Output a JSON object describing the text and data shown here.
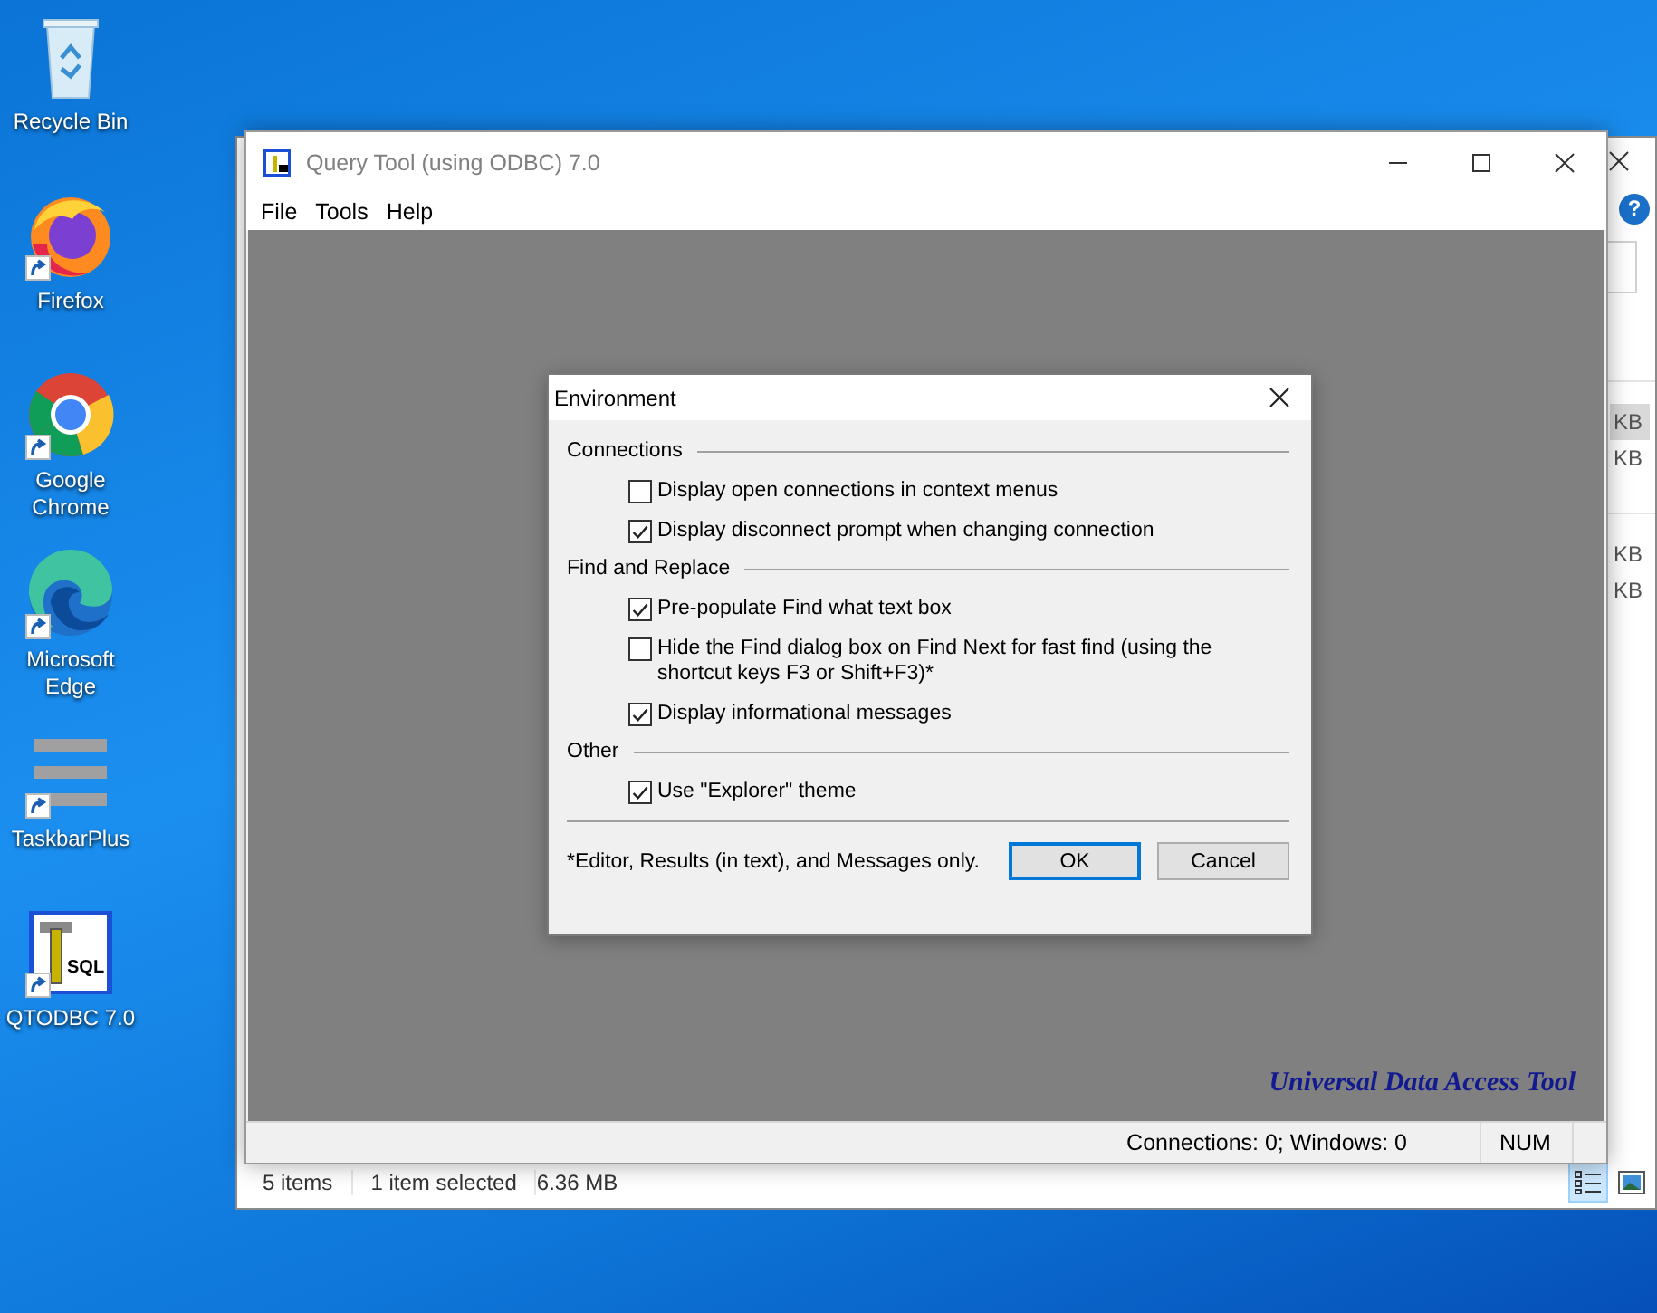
{
  "desktop": {
    "icons": [
      {
        "label": "Recycle Bin",
        "kind": "recycle",
        "shortcut": false
      },
      {
        "label": "Firefox",
        "kind": "firefox",
        "shortcut": true
      },
      {
        "label": "Google Chrome",
        "kind": "chrome",
        "shortcut": true
      },
      {
        "label": "Microsoft Edge",
        "kind": "edge",
        "shortcut": true
      },
      {
        "label": "TaskbarPlus",
        "kind": "bars",
        "shortcut": true
      },
      {
        "label": "QTODBC 7.0",
        "kind": "qtodbc",
        "shortcut": true,
        "icon_text": "SQL"
      }
    ]
  },
  "explorer_window": {
    "help_button": "?",
    "size_column": [
      {
        "text": "KB",
        "selected": true
      },
      {
        "text": "KB",
        "selected": false
      },
      {
        "text": "KB",
        "selected": false
      },
      {
        "text": "KB",
        "selected": false
      }
    ],
    "status_bar": {
      "items": "5 items",
      "selected": "1 item selected",
      "size": "6.36 MB"
    }
  },
  "query_tool": {
    "title": "Query Tool (using ODBC) 7.0",
    "menu": [
      "File",
      "Tools",
      "Help"
    ],
    "workspace_caption": "Universal Data Access Tool",
    "status_bar": [
      "Connections: 0; Windows: 0",
      "NUM"
    ]
  },
  "dialog": {
    "title": "Environment",
    "groups": [
      {
        "label": "Connections",
        "options": [
          {
            "label": "Display open connections in context menus",
            "checked": false
          },
          {
            "label": "Display disconnect prompt when changing connection",
            "checked": true
          }
        ]
      },
      {
        "label": "Find and Replace",
        "options": [
          {
            "label": "Pre-populate Find what text box",
            "checked": true
          },
          {
            "label": "Hide the Find dialog box on Find Next for fast find (using the shortcut keys F3 or Shift+F3)*",
            "checked": false
          },
          {
            "label": "Display informational messages",
            "checked": true
          }
        ]
      },
      {
        "label": "Other",
        "options": [
          {
            "label": "Use \"Explorer\" theme",
            "checked": true
          }
        ]
      }
    ],
    "footnote": "*Editor, Results (in text), and Messages only.",
    "buttons": [
      {
        "label": "OK",
        "default": true
      },
      {
        "label": "Cancel",
        "default": false
      }
    ]
  }
}
